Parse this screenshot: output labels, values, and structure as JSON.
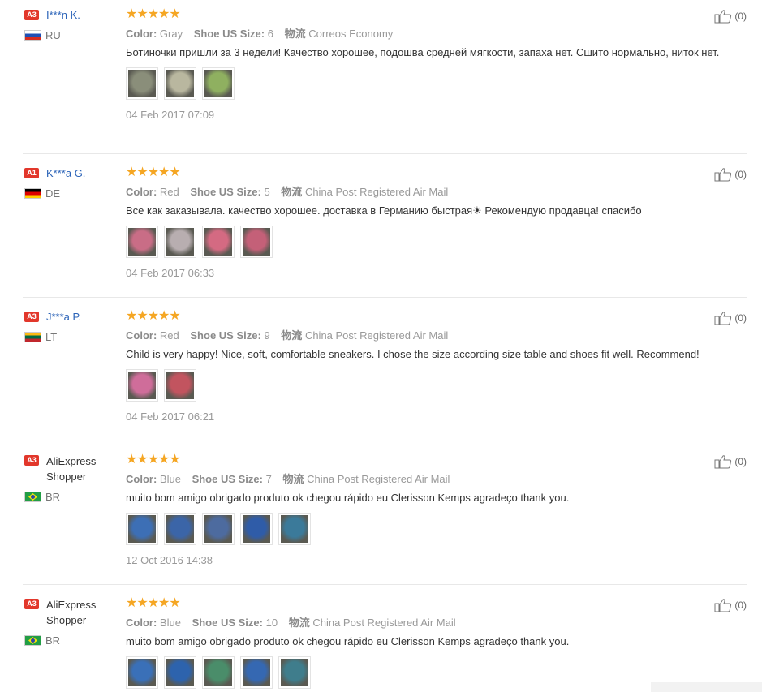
{
  "reviews": [
    {
      "badge": "A3",
      "name": "I***n K.",
      "name_style": "link",
      "flag": "ru",
      "country": "RU",
      "rating": 5,
      "helpful": "(0)",
      "color_label": "Color:",
      "color": "Gray",
      "size_label": "Shoe US Size:",
      "size": "6",
      "ship_label": "物流",
      "shipping": "Correos Economy",
      "text": "Ботиночки пришли за 3 недели! Качество хорошее, подошва средней мягкости, запаха нет. Сшито нормально, ниток нет.",
      "photos": 3,
      "date": "04 Feb 2017 07:09"
    },
    {
      "badge": "A1",
      "name": "K***a G.",
      "name_style": "link",
      "flag": "de",
      "country": "DE",
      "rating": 5,
      "helpful": "(0)",
      "color_label": "Color:",
      "color": "Red",
      "size_label": "Shoe US Size:",
      "size": "5",
      "ship_label": "物流",
      "shipping": "China Post Registered Air Mail",
      "text": "Все как заказывала. качество хорошее. доставка в Германию быстрая☀ Рекомендую продавца! спасибо",
      "photos": 4,
      "date": "04 Feb 2017 06:33"
    },
    {
      "badge": "A3",
      "name": "J***a P.",
      "name_style": "link",
      "flag": "lt",
      "country": "LT",
      "rating": 5,
      "helpful": "(0)",
      "color_label": "Color:",
      "color": "Red",
      "size_label": "Shoe US Size:",
      "size": "9",
      "ship_label": "物流",
      "shipping": "China Post Registered Air Mail",
      "text": "Child is very happy! Nice, soft, comfortable sneakers. I chose the size according size table and shoes fit well. Recommend!",
      "photos": 2,
      "date": "04 Feb 2017 06:21"
    },
    {
      "badge": "A3",
      "name": "AliExpress Shopper",
      "name_style": "plain",
      "flag": "br",
      "country": "BR",
      "rating": 5,
      "helpful": "(0)",
      "color_label": "Color:",
      "color": "Blue",
      "size_label": "Shoe US Size:",
      "size": "7",
      "ship_label": "物流",
      "shipping": "China Post Registered Air Mail",
      "text": "muito bom amigo obrigado produto ok chegou rápido eu Clerisson Kemps agradeço thank you.",
      "photos": 5,
      "date": "12 Oct 2016 14:38"
    },
    {
      "badge": "A3",
      "name": "AliExpress Shopper",
      "name_style": "plain",
      "flag": "br",
      "country": "BR",
      "rating": 5,
      "helpful": "(0)",
      "color_label": "Color:",
      "color": "Blue",
      "size_label": "Shoe US Size:",
      "size": "10",
      "ship_label": "物流",
      "shipping": "China Post Registered Air Mail",
      "text": "muito bom amigo obrigado produto ok chegou rápido eu Clerisson Kemps agradeço thank you.",
      "photos": 5,
      "date": ""
    }
  ],
  "colors": {
    "badge": "#e2372b",
    "username": "#2b63b8",
    "star": "#f5a623",
    "muted": "#999999"
  },
  "icons": {
    "star": "star-icon",
    "helpful": "thumbs-up-icon"
  }
}
